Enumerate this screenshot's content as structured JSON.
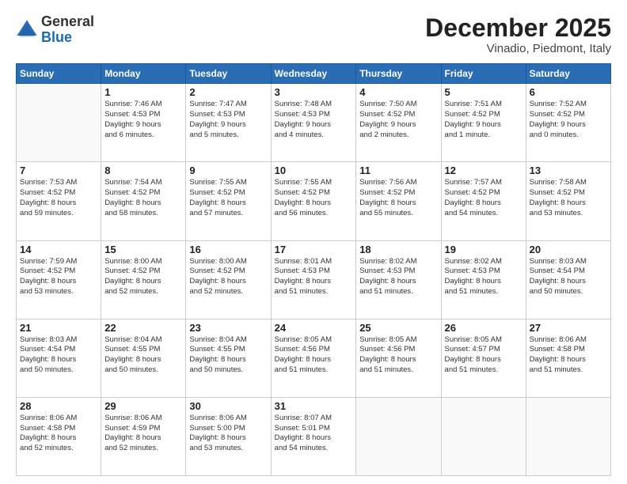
{
  "logo": {
    "general": "General",
    "blue": "Blue"
  },
  "title": "December 2025",
  "subtitle": "Vinadio, Piedmont, Italy",
  "days_of_week": [
    "Sunday",
    "Monday",
    "Tuesday",
    "Wednesday",
    "Thursday",
    "Friday",
    "Saturday"
  ],
  "weeks": [
    [
      {
        "day": "",
        "detail": ""
      },
      {
        "day": "1",
        "detail": "Sunrise: 7:46 AM\nSunset: 4:53 PM\nDaylight: 9 hours\nand 6 minutes."
      },
      {
        "day": "2",
        "detail": "Sunrise: 7:47 AM\nSunset: 4:53 PM\nDaylight: 9 hours\nand 5 minutes."
      },
      {
        "day": "3",
        "detail": "Sunrise: 7:48 AM\nSunset: 4:53 PM\nDaylight: 9 hours\nand 4 minutes."
      },
      {
        "day": "4",
        "detail": "Sunrise: 7:50 AM\nSunset: 4:52 PM\nDaylight: 9 hours\nand 2 minutes."
      },
      {
        "day": "5",
        "detail": "Sunrise: 7:51 AM\nSunset: 4:52 PM\nDaylight: 9 hours\nand 1 minute."
      },
      {
        "day": "6",
        "detail": "Sunrise: 7:52 AM\nSunset: 4:52 PM\nDaylight: 9 hours\nand 0 minutes."
      }
    ],
    [
      {
        "day": "7",
        "detail": "Sunrise: 7:53 AM\nSunset: 4:52 PM\nDaylight: 8 hours\nand 59 minutes."
      },
      {
        "day": "8",
        "detail": "Sunrise: 7:54 AM\nSunset: 4:52 PM\nDaylight: 8 hours\nand 58 minutes."
      },
      {
        "day": "9",
        "detail": "Sunrise: 7:55 AM\nSunset: 4:52 PM\nDaylight: 8 hours\nand 57 minutes."
      },
      {
        "day": "10",
        "detail": "Sunrise: 7:55 AM\nSunset: 4:52 PM\nDaylight: 8 hours\nand 56 minutes."
      },
      {
        "day": "11",
        "detail": "Sunrise: 7:56 AM\nSunset: 4:52 PM\nDaylight: 8 hours\nand 55 minutes."
      },
      {
        "day": "12",
        "detail": "Sunrise: 7:57 AM\nSunset: 4:52 PM\nDaylight: 8 hours\nand 54 minutes."
      },
      {
        "day": "13",
        "detail": "Sunrise: 7:58 AM\nSunset: 4:52 PM\nDaylight: 8 hours\nand 53 minutes."
      }
    ],
    [
      {
        "day": "14",
        "detail": "Sunrise: 7:59 AM\nSunset: 4:52 PM\nDaylight: 8 hours\nand 53 minutes."
      },
      {
        "day": "15",
        "detail": "Sunrise: 8:00 AM\nSunset: 4:52 PM\nDaylight: 8 hours\nand 52 minutes."
      },
      {
        "day": "16",
        "detail": "Sunrise: 8:00 AM\nSunset: 4:52 PM\nDaylight: 8 hours\nand 52 minutes."
      },
      {
        "day": "17",
        "detail": "Sunrise: 8:01 AM\nSunset: 4:53 PM\nDaylight: 8 hours\nand 51 minutes."
      },
      {
        "day": "18",
        "detail": "Sunrise: 8:02 AM\nSunset: 4:53 PM\nDaylight: 8 hours\nand 51 minutes."
      },
      {
        "day": "19",
        "detail": "Sunrise: 8:02 AM\nSunset: 4:53 PM\nDaylight: 8 hours\nand 51 minutes."
      },
      {
        "day": "20",
        "detail": "Sunrise: 8:03 AM\nSunset: 4:54 PM\nDaylight: 8 hours\nand 50 minutes."
      }
    ],
    [
      {
        "day": "21",
        "detail": "Sunrise: 8:03 AM\nSunset: 4:54 PM\nDaylight: 8 hours\nand 50 minutes."
      },
      {
        "day": "22",
        "detail": "Sunrise: 8:04 AM\nSunset: 4:55 PM\nDaylight: 8 hours\nand 50 minutes."
      },
      {
        "day": "23",
        "detail": "Sunrise: 8:04 AM\nSunset: 4:55 PM\nDaylight: 8 hours\nand 50 minutes."
      },
      {
        "day": "24",
        "detail": "Sunrise: 8:05 AM\nSunset: 4:56 PM\nDaylight: 8 hours\nand 51 minutes."
      },
      {
        "day": "25",
        "detail": "Sunrise: 8:05 AM\nSunset: 4:56 PM\nDaylight: 8 hours\nand 51 minutes."
      },
      {
        "day": "26",
        "detail": "Sunrise: 8:05 AM\nSunset: 4:57 PM\nDaylight: 8 hours\nand 51 minutes."
      },
      {
        "day": "27",
        "detail": "Sunrise: 8:06 AM\nSunset: 4:58 PM\nDaylight: 8 hours\nand 51 minutes."
      }
    ],
    [
      {
        "day": "28",
        "detail": "Sunrise: 8:06 AM\nSunset: 4:58 PM\nDaylight: 8 hours\nand 52 minutes."
      },
      {
        "day": "29",
        "detail": "Sunrise: 8:06 AM\nSunset: 4:59 PM\nDaylight: 8 hours\nand 52 minutes."
      },
      {
        "day": "30",
        "detail": "Sunrise: 8:06 AM\nSunset: 5:00 PM\nDaylight: 8 hours\nand 53 minutes."
      },
      {
        "day": "31",
        "detail": "Sunrise: 8:07 AM\nSunset: 5:01 PM\nDaylight: 8 hours\nand 54 minutes."
      },
      {
        "day": "",
        "detail": ""
      },
      {
        "day": "",
        "detail": ""
      },
      {
        "day": "",
        "detail": ""
      }
    ]
  ]
}
